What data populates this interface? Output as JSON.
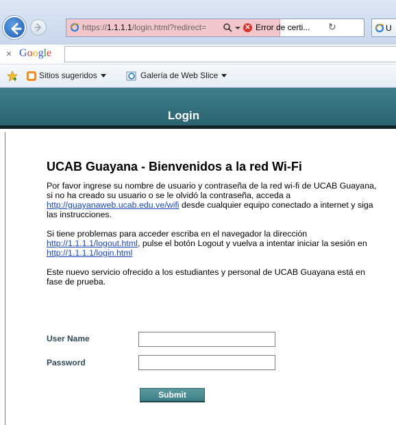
{
  "browser": {
    "url_prefix": "https://",
    "url_host": "1.1.1.1",
    "url_rest": "/login.html?redirect=",
    "cert_error": "Error de certi...",
    "tab_title": "U",
    "google_logo": "Google",
    "favorites": {
      "suggested_sites": "Sitios sugeridos",
      "web_slice_gallery": "Galería de Web Slice"
    }
  },
  "page": {
    "banner_title": "Login",
    "heading": "UCAB Guayana - Bienvenidos a la red Wi-Fi",
    "para1": {
      "before": "Por favor ingrese su nombre de usuario y contraseña de la red wi-fi de UCAB Guayana, si no ha creado su usuario o se le olvidó la contraseña, acceda a ",
      "link": "http://guayanaweb.ucab.edu.ve/wifi",
      "after": " desde cualquier equipo conectado a internet y siga las instrucciones."
    },
    "para2": {
      "before": "Si tiene problemas para acceder escriba en el navegador la dirección ",
      "link1": "http://1.1.1.1/logout.html",
      "middle": ", pulse el botón Logout y vuelva a intentar iniciar la sesión en ",
      "link2": "http://1.1.1.1/login.html"
    },
    "para3": "Este nuevo servicio ofrecido a los estudiantes y personal de UCAB Guayana está en fase de prueba.",
    "form": {
      "username_label": "User Name",
      "password_label": "Password",
      "username_value": "",
      "password_value": "",
      "submit_label": "Submit"
    }
  },
  "colors": {
    "banner": "#2f6e7b",
    "label": "#2f4a57",
    "link": "#1a47b8",
    "button": "#4a8c92"
  }
}
